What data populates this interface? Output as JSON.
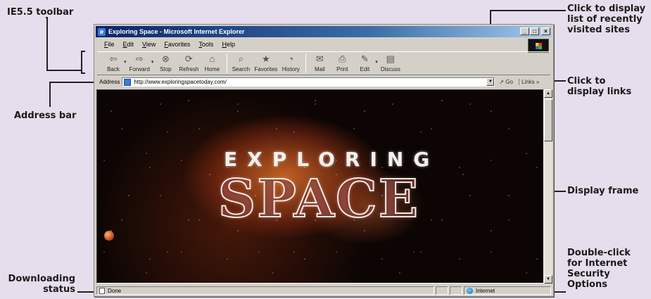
{
  "callouts": {
    "toolbar": "IE5.5 toolbar",
    "address_bar": "Address bar",
    "downloading_status_line1": "Downloading",
    "downloading_status_line2": "status",
    "recent_sites_line1": "Click to display",
    "recent_sites_line2": "list of recently",
    "recent_sites_line3": "visited sites",
    "links_line1": "Click to",
    "links_line2": "display links",
    "display_frame": "Display frame",
    "security_line1": "Double-click",
    "security_line2": "for Internet",
    "security_line3": "Security",
    "security_line4": "Options"
  },
  "window": {
    "title": "Exploring Space - Microsoft Internet Explorer",
    "controls": {
      "minimize": "_",
      "maximize": "□",
      "close": "×"
    }
  },
  "menu": [
    "File",
    "Edit",
    "View",
    "Favorites",
    "Tools",
    "Help"
  ],
  "toolbar": {
    "buttons": [
      {
        "label": "Back",
        "icon": "back-arrow-icon",
        "glyph": "⇦"
      },
      {
        "label": "Forward",
        "icon": "forward-arrow-icon",
        "glyph": "⇨"
      },
      {
        "label": "Stop",
        "icon": "stop-icon",
        "glyph": "⊗"
      },
      {
        "label": "Refresh",
        "icon": "refresh-icon",
        "glyph": "⟳"
      },
      {
        "label": "Home",
        "icon": "home-icon",
        "glyph": "⌂"
      },
      {
        "label": "Search",
        "icon": "search-icon",
        "glyph": "⌕"
      },
      {
        "label": "Favorites",
        "icon": "favorites-icon",
        "glyph": "★"
      },
      {
        "label": "History",
        "icon": "history-icon",
        "glyph": "◔"
      },
      {
        "label": "Mail",
        "icon": "mail-icon",
        "glyph": "✉"
      },
      {
        "label": "Print",
        "icon": "print-icon",
        "glyph": "⎙"
      },
      {
        "label": "Edit",
        "icon": "edit-icon",
        "glyph": "✎"
      },
      {
        "label": "Discuss",
        "icon": "discuss-icon",
        "glyph": "▤"
      }
    ]
  },
  "address": {
    "label": "Address",
    "url": "http://www.exploringspacetoday.com/",
    "go_label": "Go",
    "links_label": "Links »"
  },
  "content": {
    "heading_small": "EXPLORING",
    "heading_large": "SPACE"
  },
  "status": {
    "text": "Done",
    "zone": "Internet"
  },
  "colors": {
    "background": "#e6deec",
    "titlebar_start": "#0a246a",
    "titlebar_end": "#a6caf0",
    "chrome": "#d4d0c8"
  }
}
